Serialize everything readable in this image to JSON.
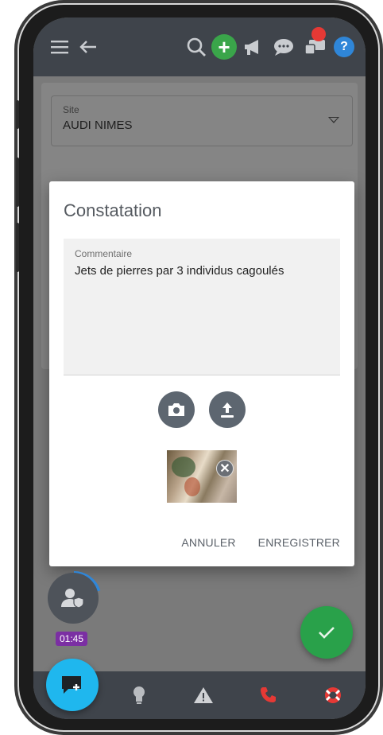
{
  "background": {
    "site_label": "Site",
    "site_value": "AUDI NIMES"
  },
  "dialog": {
    "title": "Constatation",
    "comment_label": "Commentaire",
    "comment_value": "Jets de pierres par 3 individus cagoulés",
    "cancel_label": "ANNULER",
    "save_label": "ENREGISTRER"
  },
  "timer": {
    "value": "01:45",
    "progress_fraction": 0.2
  },
  "topbar_icons": [
    "menu-icon",
    "back-arrow-icon",
    "search-icon",
    "add-icon",
    "megaphone-icon",
    "chat-bubble-icon",
    "devices-icon",
    "help-icon"
  ],
  "bottombar_icons": [
    "lightbulb-icon",
    "warning-icon",
    "phone-icon",
    "lifebuoy-icon"
  ],
  "colors": {
    "topbar": "#3f444b",
    "add_button": "#3aa54a",
    "help_button": "#2f86d8",
    "notification": "#e53935",
    "confirm_fab": "#29a14a",
    "chat_fab": "#1fb7ee",
    "timer_badge": "#7b2fa3",
    "phone_icon": "#e53935",
    "lifebuoy_icon": "#e53935"
  }
}
